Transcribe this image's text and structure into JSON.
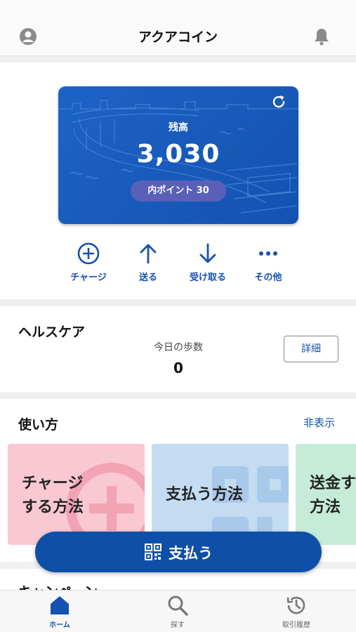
{
  "header": {
    "title": "アクアコイン",
    "avatar_icon": "user-circle-icon",
    "bell_icon": "bell-icon"
  },
  "balance": {
    "label": "残高",
    "amount": "3,030",
    "points": "内ポイント 30",
    "refresh_icon": "refresh-icon",
    "card_color": "#1d63c6"
  },
  "actions": [
    {
      "label": "チャージ",
      "icon": "plus-circle-icon"
    },
    {
      "label": "送る",
      "icon": "arrow-up-icon"
    },
    {
      "label": "受け取る",
      "icon": "arrow-down-icon"
    },
    {
      "label": "その他",
      "icon": "more-icon"
    }
  ],
  "health": {
    "title": "ヘルスケア",
    "steps_label": "今日の歩数",
    "steps_value": "0",
    "detail_label": "詳細"
  },
  "howto": {
    "title": "使い方",
    "hide_label": "非表示",
    "tiles": [
      {
        "line1": "チャージ",
        "line2": "する方法",
        "color": "#f9c8d3"
      },
      {
        "line1": "支払う方法",
        "line2": "",
        "color": "#c4dcf2"
      },
      {
        "line1": "送金す",
        "line2": "方法",
        "color": "#c6ecd9"
      }
    ]
  },
  "campaign": {
    "title": "キャンペーン"
  },
  "pay_button": {
    "label": "支払う",
    "icon": "qr-code-icon"
  },
  "tabs": [
    {
      "label": "ホーム",
      "icon": "home-icon",
      "active": true
    },
    {
      "label": "探す",
      "icon": "search-icon",
      "active": false
    },
    {
      "label": "取引履歴",
      "icon": "history-icon",
      "active": false
    }
  ],
  "colors": {
    "accent": "#1551b0",
    "pay_button": "#0e50a8"
  }
}
